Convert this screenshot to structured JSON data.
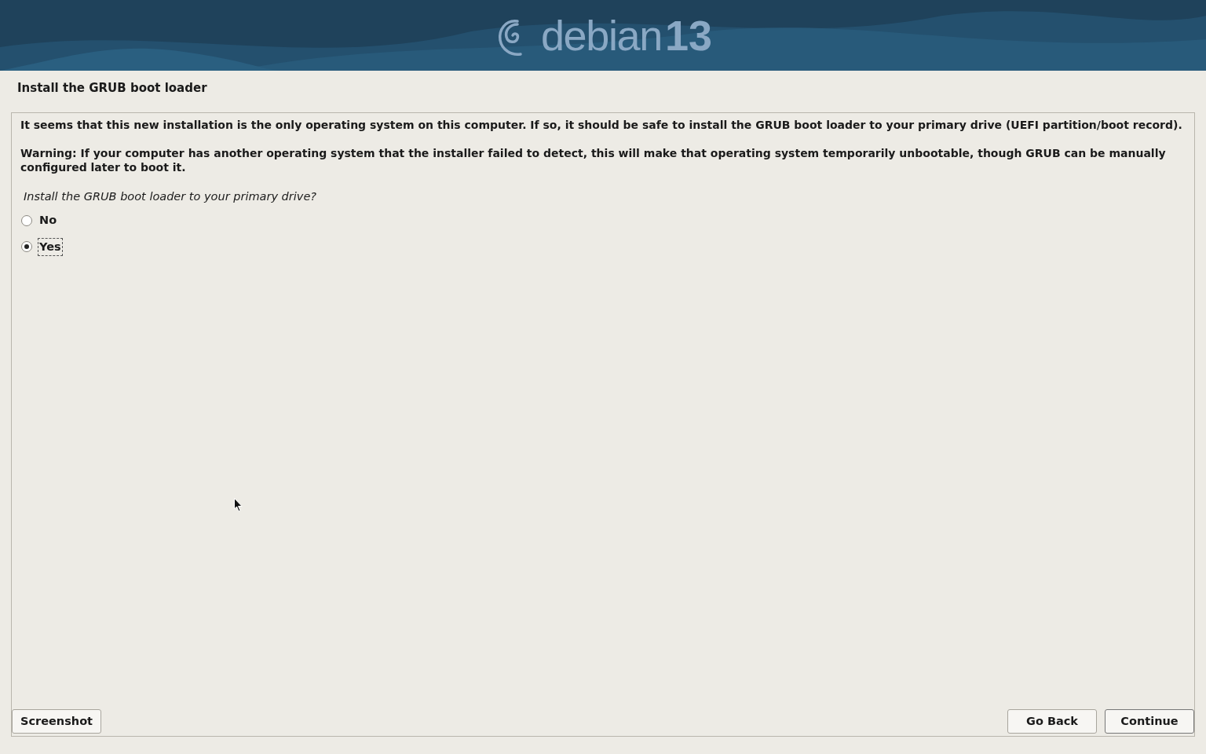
{
  "banner": {
    "logo_text": "debian",
    "version": "13"
  },
  "page_title": "Install the GRUB boot loader",
  "paragraphs": [
    "It seems that this new installation is the only operating system on this computer. If so, it should be safe to install the GRUB boot loader to your primary drive (UEFI partition/boot record).",
    "Warning: If your computer has another operating system that the installer failed to detect, this will make that operating system temporarily unbootable, though GRUB can be manually configured later to boot it."
  ],
  "question": "Install the GRUB boot loader to your primary drive?",
  "options": [
    {
      "label": "No",
      "selected": false
    },
    {
      "label": "Yes",
      "selected": true
    }
  ],
  "buttons": {
    "left": [
      "Screenshot"
    ],
    "right": [
      "Go Back",
      "Continue"
    ]
  }
}
